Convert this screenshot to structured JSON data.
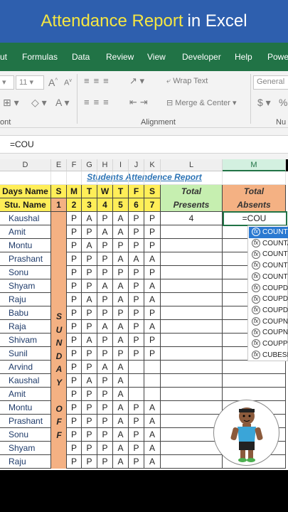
{
  "title": {
    "highlight": "Attendance Report",
    "rest": "in Excel"
  },
  "ribbon_tabs": [
    "ut",
    "Formulas",
    "Data",
    "Review",
    "View",
    "Developer",
    "Help",
    "Powe"
  ],
  "ribbon": {
    "font_size": "11",
    "wrap_text": "Wrap Text",
    "merge_center": "Merge & Center",
    "number_format": "General",
    "currency": "$",
    "percent": "%",
    "group_font": "ont",
    "group_alignment": "Alignment",
    "group_number": "Nu"
  },
  "formula_bar": {
    "value": "=COU"
  },
  "columns": [
    {
      "id": "D",
      "selected": false
    },
    {
      "id": "E",
      "selected": false
    },
    {
      "id": "F",
      "selected": false
    },
    {
      "id": "G",
      "selected": false
    },
    {
      "id": "H",
      "selected": false
    },
    {
      "id": "I",
      "selected": false
    },
    {
      "id": "J",
      "selected": false
    },
    {
      "id": "K",
      "selected": false
    },
    {
      "id": "L",
      "selected": false
    },
    {
      "id": "M",
      "selected": true
    }
  ],
  "sheet": {
    "report_title": "Students Attendence Report",
    "header_row1": {
      "days_name": "Days Name",
      "s": "S",
      "days": [
        "M",
        "T",
        "W",
        "T",
        "F",
        "S"
      ],
      "total_presents": "Total",
      "total_absents": "Total"
    },
    "header_row2": {
      "stu_name": "Stu. Name",
      "n1": "1",
      "nums": [
        "2",
        "3",
        "4",
        "5",
        "6",
        "7"
      ],
      "total_presents": "Presents",
      "total_absents": "Absents"
    },
    "sunday_letters": [
      "S",
      "U",
      "N",
      "D",
      "A",
      "Y",
      "",
      "O",
      "F",
      "F"
    ],
    "rows": [
      {
        "name": "Kaushal",
        "att": [
          "P",
          "A",
          "P",
          "A",
          "P",
          "P"
        ],
        "present": "4",
        "absent": "=COU"
      },
      {
        "name": "Amit",
        "att": [
          "P",
          "P",
          "A",
          "A",
          "P",
          "P"
        ],
        "present": "",
        "absent": ""
      },
      {
        "name": "Montu",
        "att": [
          "P",
          "A",
          "P",
          "P",
          "P",
          "P"
        ],
        "present": "",
        "absent": ""
      },
      {
        "name": "Prashant",
        "att": [
          "P",
          "P",
          "P",
          "A",
          "A",
          "A"
        ],
        "present": "",
        "absent": ""
      },
      {
        "name": "Sonu",
        "att": [
          "P",
          "P",
          "P",
          "P",
          "P",
          "P"
        ],
        "present": "",
        "absent": ""
      },
      {
        "name": "Shyam",
        "att": [
          "P",
          "P",
          "A",
          "A",
          "P",
          "A"
        ],
        "present": "",
        "absent": ""
      },
      {
        "name": "Raju",
        "att": [
          "P",
          "A",
          "P",
          "A",
          "P",
          "A"
        ],
        "present": "",
        "absent": ""
      },
      {
        "name": "Babu",
        "att": [
          "P",
          "P",
          "P",
          "P",
          "P",
          "P"
        ],
        "present": "",
        "absent": ""
      },
      {
        "name": "Raja",
        "att": [
          "P",
          "P",
          "A",
          "A",
          "P",
          "A"
        ],
        "present": "",
        "absent": ""
      },
      {
        "name": "Shivam",
        "att": [
          "P",
          "A",
          "P",
          "A",
          "P",
          "P"
        ],
        "present": "",
        "absent": ""
      },
      {
        "name": "Sunil",
        "att": [
          "P",
          "P",
          "P",
          "P",
          "P",
          "P"
        ],
        "present": "",
        "absent": ""
      },
      {
        "name": "Arvind",
        "att": [
          "P",
          "P",
          "A",
          "A",
          "",
          ""
        ],
        "present": "",
        "absent": ""
      },
      {
        "name": "Kaushal",
        "att": [
          "P",
          "A",
          "P",
          "A",
          "",
          ""
        ],
        "present": "",
        "absent": ""
      },
      {
        "name": "Amit",
        "att": [
          "P",
          "P",
          "P",
          "A",
          "",
          ""
        ],
        "present": "",
        "absent": ""
      },
      {
        "name": "Montu",
        "att": [
          "P",
          "P",
          "P",
          "A",
          "P",
          "A"
        ],
        "present": "",
        "absent": ""
      },
      {
        "name": "Prashant",
        "att": [
          "P",
          "P",
          "P",
          "A",
          "P",
          "A"
        ],
        "present": "",
        "absent": ""
      },
      {
        "name": "Sonu",
        "att": [
          "P",
          "P",
          "P",
          "A",
          "P",
          "A"
        ],
        "present": "",
        "absent": ""
      },
      {
        "name": "Shyam",
        "att": [
          "P",
          "P",
          "P",
          "A",
          "P",
          "A"
        ],
        "present": "",
        "absent": ""
      },
      {
        "name": "Raju",
        "att": [
          "P",
          "P",
          "P",
          "A",
          "P",
          "A"
        ],
        "present": "",
        "absent": ""
      }
    ]
  },
  "autocomplete": [
    "COUNT",
    "COUNTA",
    "COUNTB",
    "COUNTI",
    "COUNTI",
    "COUPD",
    "COUPD",
    "COUPD",
    "COUPN",
    "COUPN",
    "COUPP",
    "CUBESE"
  ]
}
